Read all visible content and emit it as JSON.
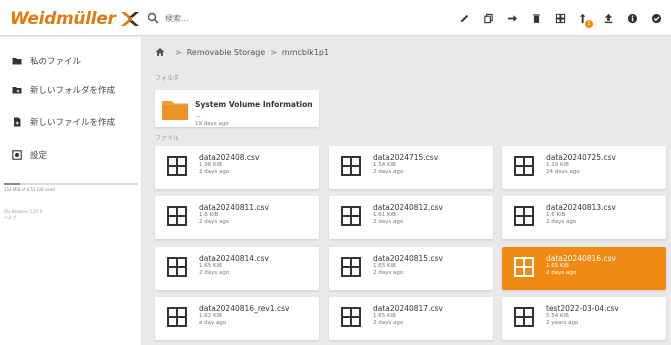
{
  "brand": {
    "name": "Weidmüller",
    "accent": "#e07b12"
  },
  "search": {
    "placeholder": "検索..."
  },
  "toolbar": [
    {
      "icon": "pencil-icon"
    },
    {
      "icon": "copy-icon"
    },
    {
      "icon": "move-icon"
    },
    {
      "icon": "delete-icon"
    },
    {
      "icon": "grid-view-icon"
    },
    {
      "icon": "sort-icon",
      "badge": "1"
    },
    {
      "icon": "upload-icon"
    },
    {
      "icon": "info-icon"
    },
    {
      "icon": "check-icon"
    }
  ],
  "sidebar": {
    "items": [
      {
        "label": "私のファイル",
        "icon": "folder-icon"
      },
      {
        "label": "新しいフォルダを作成",
        "icon": "new-folder-icon"
      },
      {
        "label": "新しいファイルを作成",
        "icon": "new-file-icon"
      },
      {
        "label": "設定",
        "icon": "settings-icon"
      }
    ],
    "storage_text": "154 MiB of 6.51 GiB used",
    "fs_text_1": "File Browser 2.27.0",
    "fs_text_2": "ヘルプ"
  },
  "breadcrumb": {
    "items": [
      "Removable Storage",
      "mmcblk1p1"
    ],
    "separator": ">"
  },
  "sections": {
    "folders": "フォルダ",
    "files": "ファイル"
  },
  "folders": [
    {
      "name": "System Volume Information",
      "size": "—",
      "modified": "19 days ago"
    }
  ],
  "files": [
    {
      "name": "data202408.csv",
      "size": "1.98 KiB",
      "modified": "2 days ago"
    },
    {
      "name": "data2024715.csv",
      "size": "1.54 KiB",
      "modified": "2 days ago"
    },
    {
      "name": "data20240725.csv",
      "size": "1.19 KiB",
      "modified": "24 days ago"
    },
    {
      "name": "data20240811.csv",
      "size": "1.6 KiB",
      "modified": "2 days ago"
    },
    {
      "name": "data20240812.csv",
      "size": "1.61 KiB",
      "modified": "2 days ago"
    },
    {
      "name": "data20240813.csv",
      "size": "1.6 KiB",
      "modified": "2 days ago"
    },
    {
      "name": "data20240814.csv",
      "size": "1.65 KiB",
      "modified": "2 days ago"
    },
    {
      "name": "data20240815.csv",
      "size": "1.65 KiB",
      "modified": "2 days ago"
    },
    {
      "name": "data20240816.csv",
      "size": "1.65 KiB",
      "modified": "2 days ago",
      "selected": true
    },
    {
      "name": "data20240816_rev1.csv",
      "size": "1.62 KiB",
      "modified": "a day ago"
    },
    {
      "name": "data20240817.csv",
      "size": "1.65 KiB",
      "modified": "2 days ago"
    },
    {
      "name": "test2022-03-04.csv",
      "size": "5.54 KiB",
      "modified": "2 years ago"
    }
  ]
}
